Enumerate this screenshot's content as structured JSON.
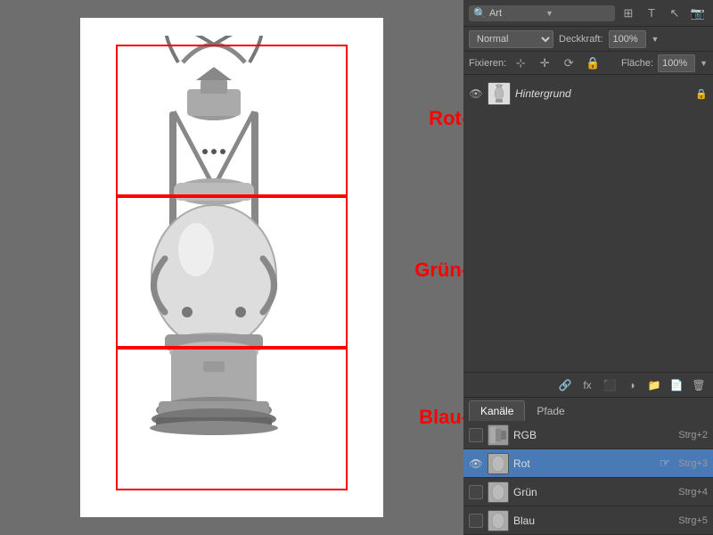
{
  "toolbar": {
    "search_placeholder": "Art",
    "blend_mode": "Normal",
    "deckkraft_label": "Deckkraft:",
    "deckkraft_value": "100%",
    "flache_label": "Fläche:",
    "flache_value": "100%",
    "fixieren_label": "Fixieren:"
  },
  "layers": [
    {
      "name": "Hintergrund",
      "visible": true,
      "locked": true
    }
  ],
  "channel_labels": {
    "rot": "Rot-Kanal",
    "gruen": "Grün-Kanal",
    "blau": "Blau-Kanal"
  },
  "tabs": [
    {
      "label": "Kanäle",
      "active": true
    },
    {
      "label": "Pfade",
      "active": false
    }
  ],
  "channels": [
    {
      "name": "RGB",
      "shortcut": "Strg+2",
      "visible": false,
      "active": false
    },
    {
      "name": "Rot",
      "shortcut": "Strg+3",
      "visible": true,
      "active": true
    },
    {
      "name": "Grün",
      "shortcut": "Strg+4",
      "visible": false,
      "active": false
    },
    {
      "name": "Blau",
      "shortcut": "Strg+5",
      "visible": false,
      "active": false
    }
  ],
  "icons": {
    "eye": "👁",
    "lock": "🔒",
    "search": "🔍",
    "link": "🔗",
    "fx": "fx",
    "new_layer": "📄",
    "folder": "📁",
    "trash": "🗑",
    "mask": "⬛",
    "adjustment": "◑",
    "arrow_down": "▼"
  }
}
